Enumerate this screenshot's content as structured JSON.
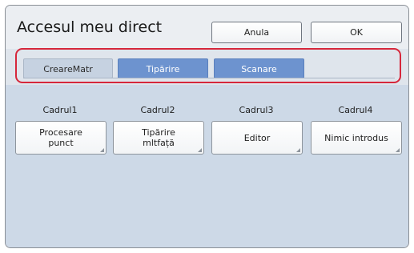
{
  "dialog": {
    "title": "Accesul meu direct",
    "cancel_label": "Anula",
    "ok_label": "OK"
  },
  "tabs": [
    {
      "label": "CreareMatr",
      "active": true
    },
    {
      "label": "Tipărire",
      "active": false
    },
    {
      "label": "Scanare",
      "active": false
    }
  ],
  "frames": [
    {
      "label": "Cadrul1",
      "button": "Procesare\npunct"
    },
    {
      "label": "Cadrul2",
      "button": "Tipărire\nmltfață"
    },
    {
      "label": "Cadrul3",
      "button": "Editor"
    },
    {
      "label": "Cadrul4",
      "button": "Nimic introdus"
    }
  ],
  "colors": {
    "highlight_border": "#d6273b",
    "tab_inactive": "#6d93cf",
    "tab_active": "#c6d2e1",
    "content_bg": "#cdd9e7"
  }
}
